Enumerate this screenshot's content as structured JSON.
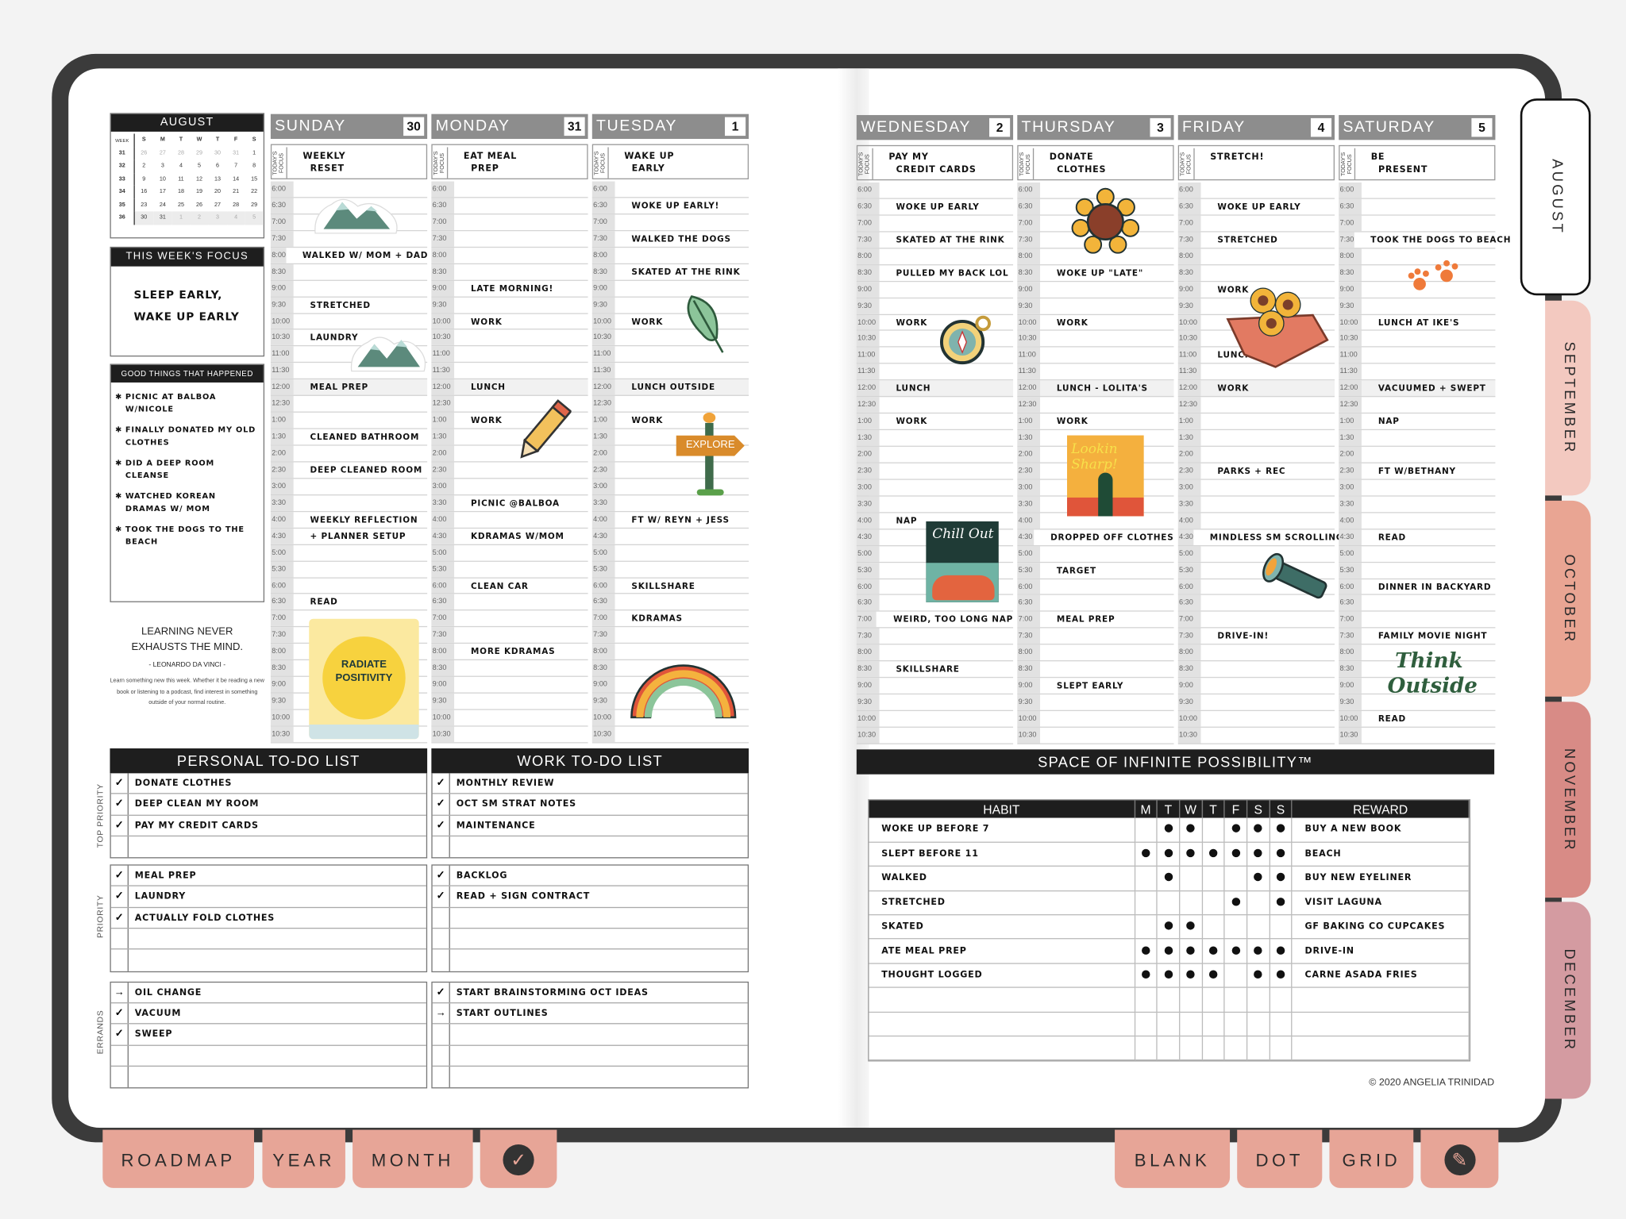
{
  "calendar": {
    "month": "AUGUST",
    "week_label": "WEEK",
    "weekdays": [
      "S",
      "M",
      "T",
      "W",
      "T",
      "F",
      "S"
    ],
    "weeks": [
      {
        "week": "31",
        "days": [
          "26",
          "27",
          "28",
          "29",
          "30",
          "31",
          "1"
        ],
        "dim": [
          true,
          true,
          true,
          true,
          true,
          true,
          false
        ]
      },
      {
        "week": "32",
        "days": [
          "2",
          "3",
          "4",
          "5",
          "6",
          "7",
          "8"
        ],
        "dim": [
          false,
          false,
          false,
          false,
          false,
          false,
          false
        ]
      },
      {
        "week": "33",
        "days": [
          "9",
          "10",
          "11",
          "12",
          "13",
          "14",
          "15"
        ],
        "dim": [
          false,
          false,
          false,
          false,
          false,
          false,
          false
        ]
      },
      {
        "week": "34",
        "days": [
          "16",
          "17",
          "18",
          "19",
          "20",
          "21",
          "22"
        ],
        "dim": [
          false,
          false,
          false,
          false,
          false,
          false,
          false
        ]
      },
      {
        "week": "35",
        "days": [
          "23",
          "24",
          "25",
          "26",
          "27",
          "28",
          "29"
        ],
        "dim": [
          false,
          false,
          false,
          false,
          false,
          false,
          false
        ]
      },
      {
        "week": "36",
        "days": [
          "30",
          "31",
          "1",
          "2",
          "3",
          "4",
          "5"
        ],
        "dim": [
          false,
          false,
          true,
          true,
          true,
          true,
          true
        ],
        "highlight": true
      }
    ]
  },
  "week_focus": {
    "title": "THIS WEEK'S FOCUS",
    "text": "SLEEP EARLY,\nWAKE UP EARLY"
  },
  "good_things": {
    "title": "GOOD THINGS THAT HAPPENED",
    "items": [
      "PICNIC AT BALBOA W/NICOLE",
      "FINALLY DONATED MY OLD CLOTHES",
      "DID A DEEP ROOM CLEANSE",
      "WATCHED KOREAN DRAMAS W/ MOM",
      "TOOK THE DOGS TO THE BEACH"
    ]
  },
  "quote": {
    "text": "LEARNING NEVER EXHAUSTS THE MIND.",
    "author": "- LEONARDO DA VINCI -",
    "body": "Learn something new this week. Whether it be reading a new book or listening to a podcast, find interest in something outside of your normal routine."
  },
  "focus_label": "TODAY'S FOCUS",
  "times": [
    "6:00",
    "6:30",
    "7:00",
    "7:30",
    "8:00",
    "8:30",
    "9:00",
    "9:30",
    "10:00",
    "10:30",
    "11:00",
    "11:30",
    "12:00",
    "12:30",
    "1:00",
    "1:30",
    "2:00",
    "2:30",
    "3:00",
    "3:30",
    "4:00",
    "4:30",
    "5:00",
    "5:30",
    "6:00",
    "6:30",
    "7:00",
    "7:30",
    "8:00",
    "8:30",
    "9:00",
    "9:30",
    "10:00",
    "10:30"
  ],
  "days": [
    {
      "name": "SUNDAY",
      "date": "30",
      "focus": "WEEKLY\n  RESET",
      "entries": {
        "8:00": "WALKED W/ MOM + DAD",
        "9:30": "STRETCHED",
        "10:30": "LAUNDRY",
        "12:00": "MEAL PREP",
        "1:30": "CLEANED BATHROOM",
        "2:30": "DEEP CLEANED ROOM",
        "4:00": "WEEKLY REFLECTION",
        "4:30": "+ PLANNER SETUP",
        "6:30 PM": "READ"
      }
    },
    {
      "name": "MONDAY",
      "date": "31",
      "focus": "EAT MEAL\n  PREP",
      "entries": {
        "9:00": "LATE MORNING!",
        "10:00": "WORK",
        "12:00": "LUNCH",
        "1:00": "WORK",
        "3:30": "PICNIC @BALBOA",
        "4:30": "KDRAMAS W/MOM",
        "6:00 PM": "CLEAN CAR",
        "8:00 PM": "MORE KDRAMAS"
      }
    },
    {
      "name": "TUESDAY",
      "date": "1",
      "focus": "WAKE UP\n  EARLY",
      "entries": {
        "6:30": "WOKE UP EARLY!",
        "7:30": "WALKED THE DOGS",
        "8:30": "SKATED AT THE RINK",
        "10:00": "WORK",
        "12:00": "LUNCH OUTSIDE",
        "1:00": "WORK",
        "4:00": "FT W/ REYN + JESS",
        "6:00 PM": "SKILLSHARE",
        "7:00 PM": "KDRAMAS"
      }
    },
    {
      "name": "WEDNESDAY",
      "date": "2",
      "focus": "PAY MY\n  CREDIT CARDS",
      "entries": {
        "6:30": "WOKE UP EARLY",
        "7:30": "SKATED AT THE RINK",
        "8:30": "PULLED MY BACK LOL",
        "10:00": "WORK",
        "12:00": "LUNCH",
        "1:00": "WORK",
        "4:00": "NAP",
        "7:00 PM": "WEIRD, TOO LONG NAP",
        "8:30 PM": "SKILLSHARE"
      }
    },
    {
      "name": "THURSDAY",
      "date": "3",
      "focus": "DONATE\n  CLOTHES",
      "entries": {
        "8:30": "WOKE UP \"LATE\"",
        "10:00": "WORK",
        "12:00": "LUNCH - LOLITA'S",
        "1:00": "WORK",
        "4:30": "DROPPED OFF CLOTHES",
        "5:30": "TARGET",
        "7:00 PM": "MEAL PREP",
        "9:00 PM": "SLEPT EARLY"
      }
    },
    {
      "name": "FRIDAY",
      "date": "4",
      "focus": "STRETCH!",
      "entries": {
        "6:30": "WOKE UP EARLY",
        "7:30": "STRETCHED",
        "9:00": "WORK",
        "11:00": "LUNCH",
        "12:00": "WORK",
        "2:30": "PARKS + REC",
        "4:30": "MINDLESS SM SCROLLING",
        "7:30 PM": "DRIVE-IN!"
      }
    },
    {
      "name": "SATURDAY",
      "date": "5",
      "focus": "BE\n  PRESENT",
      "entries": {
        "7:30": "TOOK THE DOGS TO BEACH",
        "10:00": "LUNCH AT IKE'S",
        "12:00": "VACUUMED + SWEPT",
        "1:00": "NAP",
        "2:30": "FT W/BETHANY",
        "4:30": "READ",
        "6:00 PM": "DINNER IN BACKYARD",
        "7:30 PM": "FAMILY MOVIE NIGHT",
        "10:00 PM": "READ"
      }
    }
  ],
  "todo": {
    "section_labels": [
      "TOP PRIORITY",
      "PRIORITY",
      "ERRANDS"
    ],
    "personal": {
      "title": "PERSONAL TO-DO LIST",
      "sections": [
        [
          {
            "mark": "✓",
            "text": "DONATE CLOTHES"
          },
          {
            "mark": "✓",
            "text": "DEEP CLEAN MY ROOM"
          },
          {
            "mark": "✓",
            "text": "PAY MY CREDIT CARDS"
          },
          {
            "mark": "",
            "text": ""
          }
        ],
        [
          {
            "mark": "✓",
            "text": "MEAL PREP"
          },
          {
            "mark": "✓",
            "text": "LAUNDRY"
          },
          {
            "mark": "✓",
            "text": "ACTUALLY FOLD CLOTHES"
          },
          {
            "mark": "",
            "text": ""
          },
          {
            "mark": "",
            "text": ""
          }
        ],
        [
          {
            "mark": "→",
            "text": "OIL CHANGE"
          },
          {
            "mark": "✓",
            "text": "VACUUM"
          },
          {
            "mark": "✓",
            "text": "SWEEP"
          },
          {
            "mark": "",
            "text": ""
          },
          {
            "mark": "",
            "text": ""
          }
        ]
      ]
    },
    "work": {
      "title": "WORK TO-DO LIST",
      "sections": [
        [
          {
            "mark": "✓",
            "text": "MONTHLY REVIEW"
          },
          {
            "mark": "✓",
            "text": "OCT SM STRAT NOTES"
          },
          {
            "mark": "✓",
            "text": "MAINTENANCE"
          },
          {
            "mark": "",
            "text": ""
          }
        ],
        [
          {
            "mark": "✓",
            "text": "BACKLOG"
          },
          {
            "mark": "✓",
            "text": "READ + SIGN CONTRACT"
          },
          {
            "mark": "",
            "text": ""
          },
          {
            "mark": "",
            "text": ""
          },
          {
            "mark": "",
            "text": ""
          }
        ],
        [
          {
            "mark": "✓",
            "text": "START BRAINSTORMING OCT IDEAS"
          },
          {
            "mark": "→",
            "text": "START OUTLINES"
          },
          {
            "mark": "",
            "text": ""
          },
          {
            "mark": "",
            "text": ""
          },
          {
            "mark": "",
            "text": ""
          }
        ]
      ]
    }
  },
  "space_banner": "SPACE OF INFINITE POSSIBILITY™",
  "habits": {
    "habit_header": "HABIT",
    "reward_header": "REWARD",
    "days": [
      "M",
      "T",
      "W",
      "T",
      "F",
      "S",
      "S"
    ],
    "rows": [
      {
        "habit": "WOKE UP BEFORE 7",
        "done": [
          0,
          1,
          1,
          0,
          1,
          1,
          1
        ],
        "reward": "BUY A NEW BOOK"
      },
      {
        "habit": "SLEPT BEFORE 11",
        "done": [
          1,
          1,
          1,
          1,
          1,
          1,
          1
        ],
        "reward": "BEACH"
      },
      {
        "habit": "WALKED",
        "done": [
          0,
          1,
          0,
          0,
          0,
          1,
          1
        ],
        "reward": "BUY NEW EYELINER"
      },
      {
        "habit": "STRETCHED",
        "done": [
          0,
          0,
          0,
          0,
          1,
          0,
          1
        ],
        "reward": "VISIT LAGUNA"
      },
      {
        "habit": "SKATED",
        "done": [
          0,
          1,
          1,
          0,
          0,
          0,
          0
        ],
        "reward": "GF BAKING CO CUPCAKES"
      },
      {
        "habit": "ATE MEAL PREP",
        "done": [
          1,
          1,
          1,
          1,
          1,
          1,
          1
        ],
        "reward": "DRIVE-IN"
      },
      {
        "habit": "THOUGHT LOGGED",
        "done": [
          1,
          1,
          1,
          1,
          0,
          1,
          1
        ],
        "reward": "CARNE ASADA FRIES"
      },
      {
        "habit": "",
        "done": [
          0,
          0,
          0,
          0,
          0,
          0,
          0
        ],
        "reward": ""
      },
      {
        "habit": "",
        "done": [
          0,
          0,
          0,
          0,
          0,
          0,
          0
        ],
        "reward": ""
      },
      {
        "habit": "",
        "done": [
          0,
          0,
          0,
          0,
          0,
          0,
          0
        ],
        "reward": ""
      }
    ]
  },
  "copyright": "© 2020 ANGELIA TRINIDAD",
  "month_tabs": [
    {
      "label": "AUGUST",
      "color": "#ffffff",
      "active": true
    },
    {
      "label": "SEPTEMBER",
      "color": "#f3c9c0"
    },
    {
      "label": "OCTOBER",
      "color": "#e9a593"
    },
    {
      "label": "NOVEMBER",
      "color": "#d88b86"
    },
    {
      "label": "DECEMBER",
      "color": "#d49ba1"
    }
  ],
  "bottom_tabs_left": [
    {
      "label": "ROADMAP"
    },
    {
      "label": "YEAR"
    },
    {
      "label": "MONTH"
    },
    {
      "label": "",
      "icon": "check-circle-icon"
    }
  ],
  "bottom_tabs_right": [
    {
      "label": "BLANK"
    },
    {
      "label": "DOT"
    },
    {
      "label": "GRID"
    },
    {
      "label": "",
      "icon": "pen-circle-icon"
    }
  ],
  "stickers": {
    "radiate": "RADIATE POSITIVITY",
    "explore": "EXPLORE",
    "chill": "Chill Out",
    "sharp": "Lookin Sharp!",
    "think": "Think Outside"
  },
  "colors": {
    "tab": "#e7a597",
    "header_gray": "#8d8d8d",
    "frame": "#3b3b3b"
  }
}
